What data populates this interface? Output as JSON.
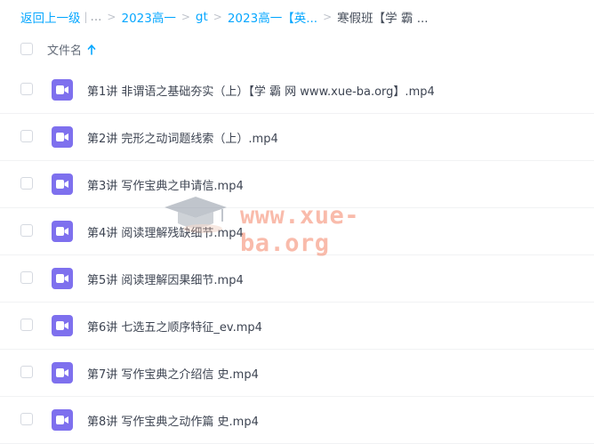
{
  "breadcrumb": {
    "back_label": "返回上一级",
    "divider": "|",
    "ellipsis": "...",
    "items": [
      "2023高一",
      "gt",
      "2023高一【英...",
      "寒假班【学 霸 ..."
    ]
  },
  "header": {
    "column_label": "文件名"
  },
  "files": [
    "第1讲 非谓语之基础夯实（上）【学 霸 网 www.xue-ba.org】.mp4",
    "第2讲 完形之动词题线索（上）.mp4",
    "第3讲 写作宝典之申请信.mp4",
    "第4讲 阅读理解残缺细节.mp4",
    "第5讲 阅读理解因果细节.mp4",
    "第6讲 七选五之顺序特征_ev.mp4",
    "第7讲 写作宝典之介绍信 史.mp4",
    "第8讲 写作宝典之动作篇 史.mp4"
  ],
  "watermark": {
    "text": "www.xue-ba.org"
  },
  "colors": {
    "link": "#06a7ff",
    "video_icon": "#7e70ee",
    "watermark": "#f26b46"
  },
  "icons": {
    "sort": "arrow-up-icon",
    "file": "video-file-icon",
    "watermark": "graduation-cap-icon"
  }
}
